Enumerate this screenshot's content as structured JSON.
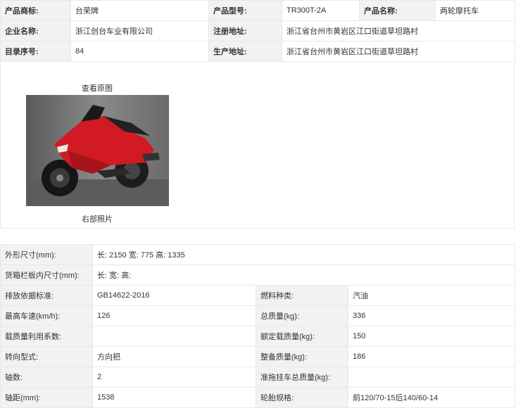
{
  "top": {
    "brand_label": "产品商标:",
    "brand_value": "台荣牌",
    "model_label": "产品型号:",
    "model_value": "TR300T-2A",
    "name_label": "产品名称:",
    "name_value": "两轮摩托车",
    "company_label": "企业名称:",
    "company_value": "浙江创台车业有限公司",
    "reg_addr_label": "注册地址:",
    "reg_addr_value": "浙江省台州市黄岩区江口街道草坦路村",
    "catalog_label": "目录序号:",
    "catalog_value": "84",
    "prod_addr_label": "生产地址:",
    "prod_addr_value": "浙江省台州市黄岩区江口街道草坦路村"
  },
  "photo": {
    "view_original": "查看原图",
    "caption": "右部照片"
  },
  "specs": {
    "dim_label": "外形尺寸(mm):",
    "dim_value": "长: 2150 宽: 775 高: 1335",
    "cargo_label": "货箱栏板内尺寸(mm):",
    "cargo_value": "长:   宽:   高:",
    "emission_label": "排放依据标准:",
    "emission_value": "GB14622-2016",
    "fuel_label": "燃料种类:",
    "fuel_value": "汽油",
    "speed_label": "最高车速(km/h):",
    "speed_value": "126",
    "total_mass_label": "总质量(kg):",
    "total_mass_value": "336",
    "load_util_label": "载质量利用系数:",
    "load_util_value": "",
    "rated_load_label": "额定载质量(kg):",
    "rated_load_value": "150",
    "steering_label": "转向型式:",
    "steering_value": "方向把",
    "curb_mass_label": "整备质量(kg):",
    "curb_mass_value": "186",
    "axles_label": "轴数:",
    "axles_value": "2",
    "trailer_label": "准拖挂车总质量(kg):",
    "trailer_value": "",
    "wheelbase_label": "轴距(mm):",
    "wheelbase_value": "1538",
    "tire_label": "轮胎规格:",
    "tire_value": "前120/70-15后140/60-14"
  }
}
